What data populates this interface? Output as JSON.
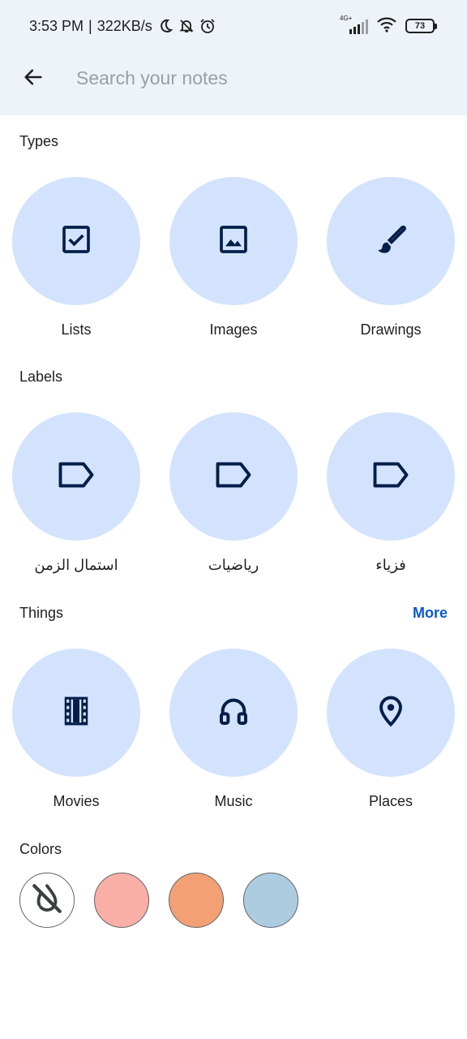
{
  "status_bar": {
    "time": "3:53 PM",
    "separator": "|",
    "speed": "322KB/s",
    "network_label": "4G+",
    "battery": "73",
    "icons": [
      "moon-icon",
      "bell-off-icon",
      "alarm-icon",
      "signal-icon",
      "wifi-icon",
      "battery-icon"
    ]
  },
  "search": {
    "placeholder": "Search your notes",
    "value": ""
  },
  "sections": {
    "types": {
      "title": "Types",
      "items": [
        {
          "label": "Lists",
          "icon": "checkbox-icon"
        },
        {
          "label": "Images",
          "icon": "image-icon"
        },
        {
          "label": "Drawings",
          "icon": "brush-icon"
        }
      ]
    },
    "labels": {
      "title": "Labels",
      "items": [
        {
          "label": "استمال الزمن",
          "icon": "label-icon"
        },
        {
          "label": "رياضيات",
          "icon": "label-icon"
        },
        {
          "label": "فزياء",
          "icon": "label-icon"
        }
      ]
    },
    "things": {
      "title": "Things",
      "more": "More",
      "items": [
        {
          "label": "Movies",
          "icon": "film-icon"
        },
        {
          "label": "Music",
          "icon": "headphones-icon"
        },
        {
          "label": "Places",
          "icon": "location-pin-icon"
        }
      ]
    },
    "colors": {
      "title": "Colors",
      "swatches": [
        {
          "name": "no-color",
          "color": "#ffffff",
          "icon": "color-off-icon"
        },
        {
          "name": "coral",
          "color": "#f9afa6"
        },
        {
          "name": "peach",
          "color": "#f2a074"
        },
        {
          "name": "fog",
          "color": "#aecce0"
        }
      ]
    }
  },
  "theme": {
    "accent": "#0b57d0",
    "tile_bg": "#d3e3fd",
    "icon_color": "#041e49",
    "header_bg": "#eef2f9"
  }
}
